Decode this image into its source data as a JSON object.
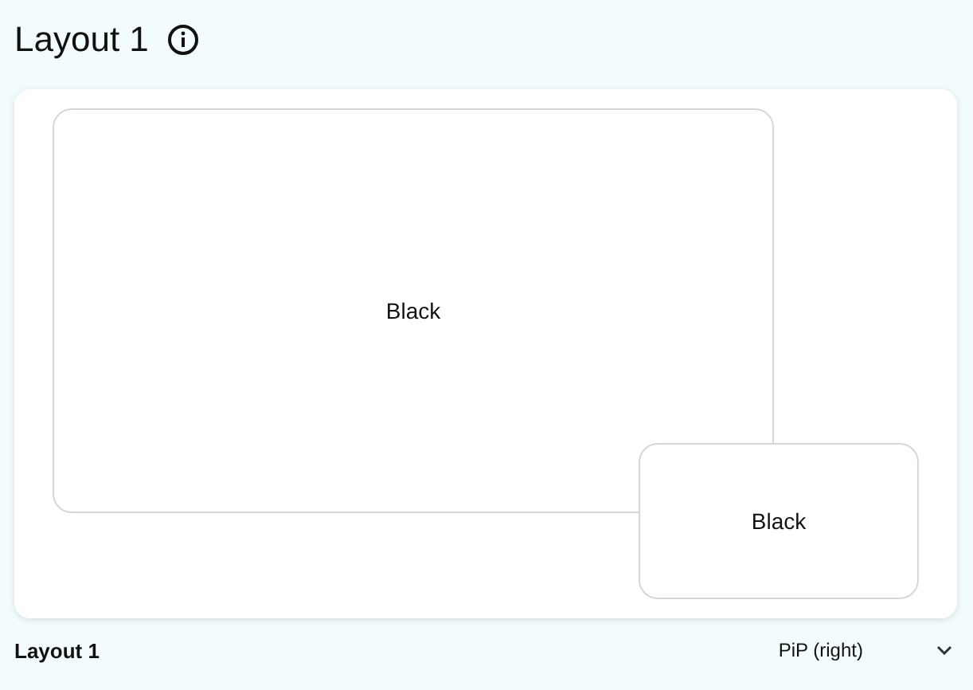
{
  "title": "Layout 1",
  "preview": {
    "frames": [
      {
        "kind": "main",
        "label": "Black"
      },
      {
        "kind": "pip",
        "label": "Black"
      }
    ]
  },
  "footer": {
    "name": "Layout 1",
    "layout_select": {
      "value": "PiP (right)"
    }
  }
}
